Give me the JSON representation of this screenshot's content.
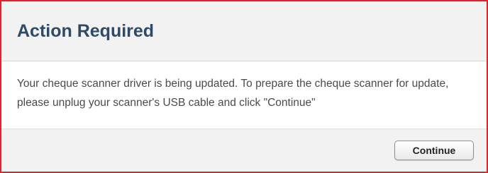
{
  "dialog": {
    "title": "Action Required",
    "message": "Your cheque scanner driver is being updated. To prepare the cheque scanner for update, please unplug your scanner's USB cable and click \"Continue\"",
    "continue_label": "Continue"
  },
  "colors": {
    "border": "#e0242a",
    "title": "#2f4a66",
    "header_background": "#f2f2f2",
    "body_text": "#4a4a4a"
  }
}
